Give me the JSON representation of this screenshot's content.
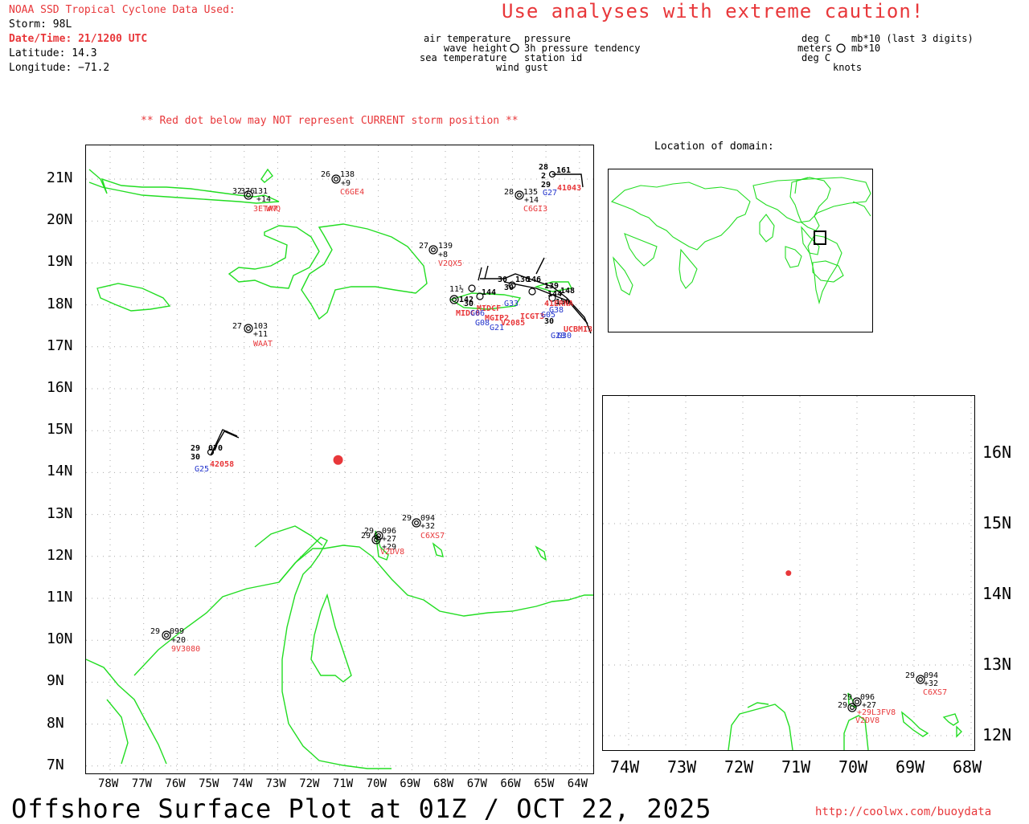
{
  "header": {
    "source": "NOAA SSD Tropical Cyclone Data Used:",
    "storm": "Storm: 98L",
    "datetime": "Date/Time: 21/1200 UTC",
    "latitude": "Latitude: 14.3",
    "longitude": "Longitude: −71.2",
    "caution": "Use analyses with extreme caution!",
    "red_dot_note": "** Red dot below may NOT represent CURRENT storm position **"
  },
  "legend": {
    "left": {
      "air_temperature": "air temperature",
      "pressure": "pressure",
      "wave_height": "wave height",
      "pressure_tendency": "3h pressure tendency",
      "sea_temperature": "sea temperature",
      "station_id": "station id",
      "wind_gust": "wind gust"
    },
    "right": {
      "deg_c_1": "deg C",
      "mb10": "mb*10 (last 3 digits)",
      "meters": "meters",
      "mb10_b": "mb*10",
      "deg_c_2": "deg C",
      "knots": "knots"
    }
  },
  "location_title": "Location of domain:",
  "footer": {
    "title": "Offshore Surface Plot at 01Z / OCT 22, 2025",
    "url": "http://coolwx.com/buoydata"
  },
  "colors": {
    "land": "#22dd22",
    "marker": "#e8373a",
    "station_id": "#e8373a",
    "ship_id": "#2233cc"
  },
  "main_map": {
    "lat_labels": [
      "21N",
      "20N",
      "19N",
      "18N",
      "17N",
      "16N",
      "15N",
      "14N",
      "13N",
      "12N",
      "11N",
      "10N",
      "9N",
      "8N",
      "7N"
    ],
    "lon_labels": [
      "78W",
      "77W",
      "76W",
      "75W",
      "74W",
      "73W",
      "72W",
      "71W",
      "70W",
      "69W",
      "68W",
      "67W",
      "66W",
      "65W",
      "64W"
    ],
    "storm_marker": {
      "lat": 14.3,
      "lon": -71.2
    },
    "stations": [
      {
        "air": "26",
        "pres": "138",
        "tend": "+9",
        "id": "C6GE4"
      },
      {
        "air": "32",
        "pres": "131",
        "tend": "+14",
        "id": "3ETA7",
        "extra": "376",
        "id2": "WNQ"
      },
      {
        "air": "28",
        "pres": "135",
        "tend": "+14",
        "id": "C6GI3"
      },
      {
        "air": "28",
        "pres": "161",
        "air2": "2",
        "sea": "29",
        "id": "41043",
        "id2": "G27"
      },
      {
        "air": "27",
        "pres": "139",
        "tend": "+8",
        "id": "V2QX5"
      },
      {
        "air": "27",
        "pres": "103",
        "tend": "+11",
        "id": "WAAT"
      },
      {
        "air": "29",
        "pres": "070",
        "sea": "30",
        "id": "42058",
        "id2": "G25"
      },
      {
        "air": "29",
        "pres": "094",
        "tend": "+32",
        "id": "C6XS7"
      },
      {
        "air": "29",
        "pres": "096",
        "tend": "+27",
        "id": "V2DV8"
      },
      {
        "air": "29",
        "pres": "099",
        "tend": "+20",
        "id": "9V3080"
      },
      {
        "air": "11½",
        "pres": "142",
        "sea": "30",
        "id": "MIDC6",
        "id2": "G08"
      },
      {
        "air": "30",
        "pres": "144",
        "id": "G21"
      }
    ]
  },
  "inset_map": {
    "lat_labels": [
      "16N",
      "15N",
      "14N",
      "13N",
      "12N"
    ],
    "lon_labels": [
      "74W",
      "73W",
      "72W",
      "71W",
      "70W",
      "69W",
      "68W"
    ],
    "stations": [
      {
        "air": "29",
        "pres": "094",
        "tend": "+32",
        "id": "C6XS7"
      },
      {
        "air": "29",
        "pres": "096",
        "tend": "+27",
        "id": "V2DV8",
        "tend2": "+29",
        "id2": "L3FV8"
      }
    ]
  }
}
